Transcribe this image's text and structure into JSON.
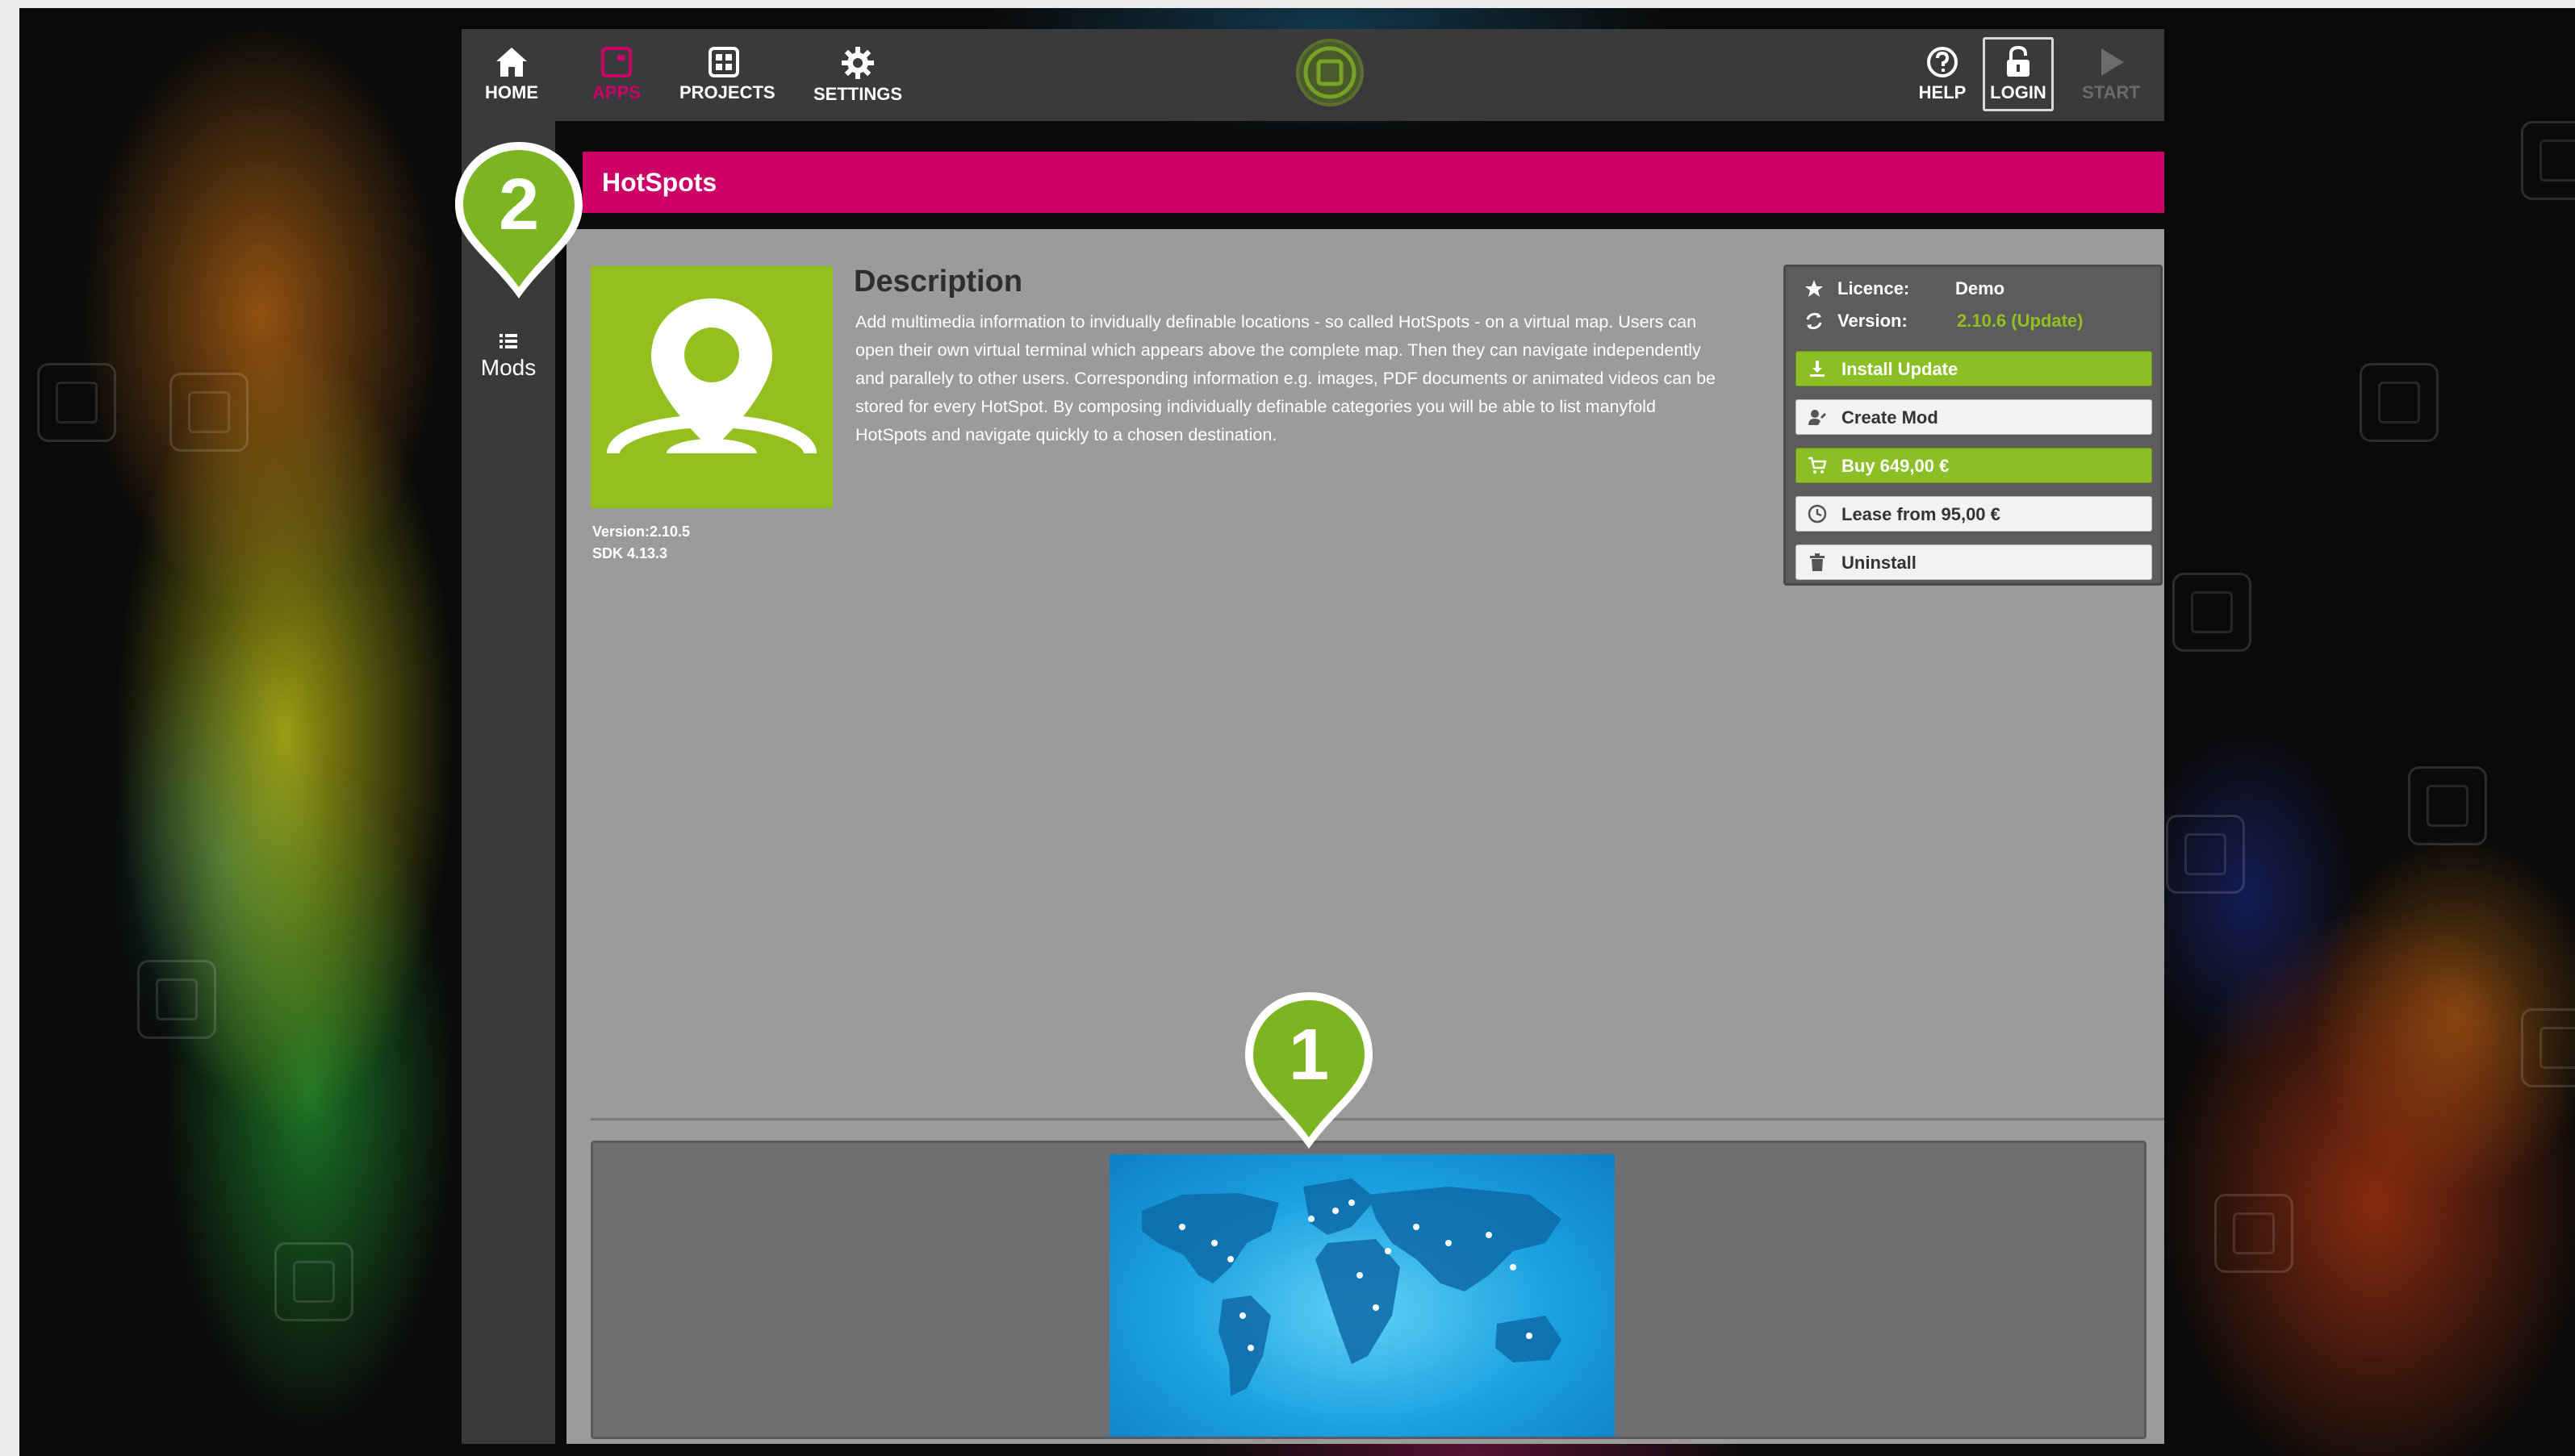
{
  "nav": {
    "home": "HOME",
    "apps": "APPS",
    "projects": "PROJECTS",
    "settings": "SETTINGS",
    "help": "HELP",
    "login": "LOGIN",
    "start": "START"
  },
  "sidebar": {
    "mods_label": "Mods"
  },
  "app": {
    "title": "HotSpots",
    "version_line": "Version:2.10.5",
    "sdk_line": "SDK 4.13.3"
  },
  "description": {
    "title": "Description",
    "body": "Add multimedia information to invidually definable locations - so called HotSpots - on a virtual map. Users can open their own virtual terminal which appears above the complete map. Then they can navigate independently and parallely to other users. Corresponding information e.g. images, PDF documents or animated videos can be stored for every HotSpot. By composing individually definable categories you will be able to list manyfold HotSpots and navigate quickly to a chosen destination."
  },
  "panel": {
    "licence_label": "Licence:",
    "licence_value": "Demo",
    "version_label": "Version:",
    "version_value": "2.10.6 (Update)",
    "install_update": "Install Update",
    "create_mod": "Create Mod",
    "buy": "Buy 649,00 €",
    "lease": "Lease from 95,00 €",
    "uninstall": "Uninstall"
  },
  "callouts": {
    "one": "1",
    "two": "2"
  },
  "colors": {
    "accent_magenta": "#cc0066",
    "accent_green": "#8cbf26",
    "chrome_dark": "#3a3a3c",
    "content_gray": "#9b9b9b"
  },
  "icons": {
    "home": "house-icon",
    "apps": "app-window-icon",
    "projects": "grid-icon",
    "settings": "gear-icon",
    "help": "question-circle-icon",
    "login": "padlock-open-icon",
    "start": "play-triangle-icon"
  }
}
